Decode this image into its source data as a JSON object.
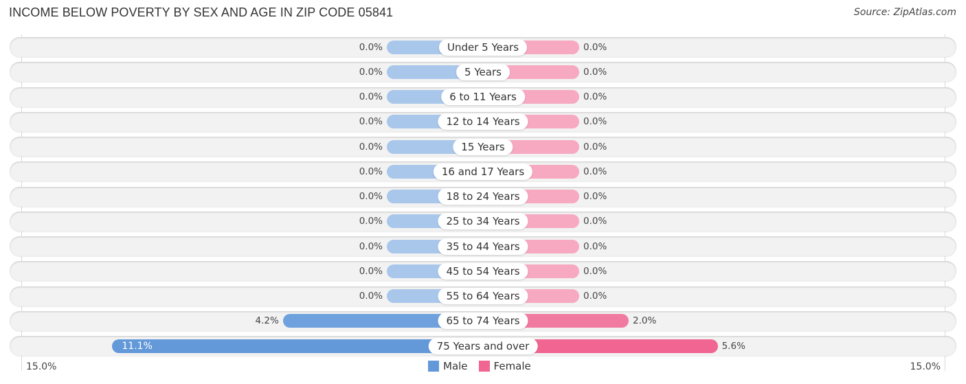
{
  "header": {
    "title": "INCOME BELOW POVERTY BY SEX AND AGE IN ZIP CODE 05841",
    "source": "Source: ZipAtlas.com"
  },
  "colors": {
    "male_light": "#a9c7ea",
    "female_light": "#f6a9c0",
    "male": "#6399d9",
    "female": "#f06592",
    "track": "#f2f2f2"
  },
  "chart_data": {
    "type": "bar",
    "orientation": "horizontal-diverging",
    "title": "INCOME BELOW POVERTY BY SEX AND AGE IN ZIP CODE 05841",
    "categories": [
      "Under 5 Years",
      "5 Years",
      "6 to 11 Years",
      "12 to 14 Years",
      "15 Years",
      "16 and 17 Years",
      "18 to 24 Years",
      "25 to 34 Years",
      "35 to 44 Years",
      "45 to 54 Years",
      "55 to 64 Years",
      "65 to 74 Years",
      "75 Years and over"
    ],
    "series": [
      {
        "name": "Male",
        "values": [
          0.0,
          0.0,
          0.0,
          0.0,
          0.0,
          0.0,
          0.0,
          0.0,
          0.0,
          0.0,
          0.0,
          4.2,
          11.1
        ],
        "labels": [
          "0.0%",
          "0.0%",
          "0.0%",
          "0.0%",
          "0.0%",
          "0.0%",
          "0.0%",
          "0.0%",
          "0.0%",
          "0.0%",
          "0.0%",
          "4.2%",
          "11.1%"
        ]
      },
      {
        "name": "Female",
        "values": [
          0.0,
          0.0,
          0.0,
          0.0,
          0.0,
          0.0,
          0.0,
          0.0,
          0.0,
          0.0,
          0.0,
          2.0,
          5.6
        ],
        "labels": [
          "0.0%",
          "0.0%",
          "0.0%",
          "0.0%",
          "0.0%",
          "0.0%",
          "0.0%",
          "0.0%",
          "0.0%",
          "0.0%",
          "0.0%",
          "2.0%",
          "5.6%"
        ]
      }
    ],
    "xlim": [
      -15.0,
      15.0
    ],
    "axis_labels": {
      "left": "15.0%",
      "right": "15.0%"
    },
    "legend": {
      "position": "bottom-center",
      "entries": [
        "Male",
        "Female"
      ]
    },
    "xlabel": "",
    "ylabel": ""
  }
}
